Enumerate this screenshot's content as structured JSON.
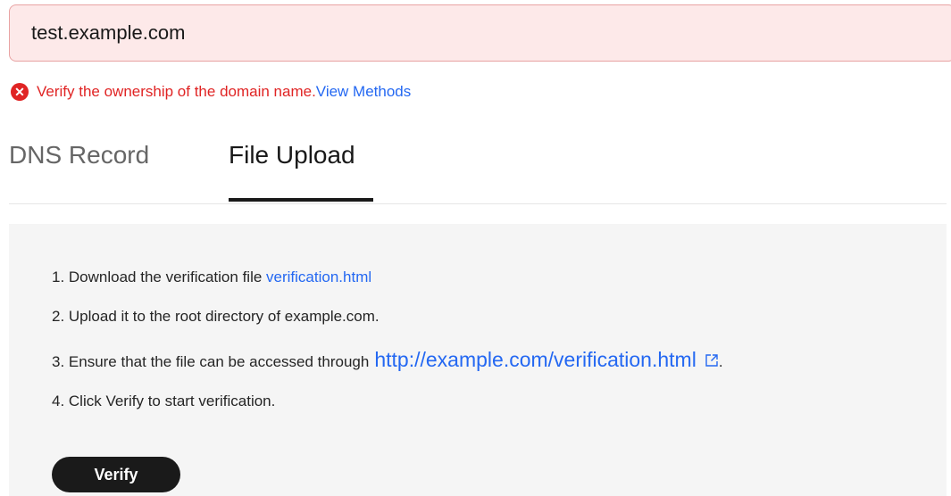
{
  "domain_input": {
    "value": "test.example.com",
    "state_color": "#e02424"
  },
  "error": {
    "icon": "error-circle-icon",
    "message": "Verify the ownership of the domain name.",
    "link_label": "View Methods"
  },
  "tabs": [
    {
      "label": "DNS Record",
      "active": false
    },
    {
      "label": "File Upload",
      "active": true
    }
  ],
  "steps": {
    "step1_prefix": "1. Download the verification file ",
    "step1_link": "verification.html",
    "step2": "2. Upload it to the root directory of example.com.",
    "step3_prefix": "3. Ensure that the file can be accessed through",
    "step3_url": "http://example.com/verification.html",
    "step3_suffix": ".",
    "step4": "4. Click Verify to start verification."
  },
  "verify_button": {
    "label": "Verify"
  },
  "colors": {
    "link": "#2468f2",
    "error": "#e02424",
    "input_error_bg": "#fde9e9",
    "panel_bg": "#f5f5f5",
    "primary_button": "#1a1a1a"
  }
}
